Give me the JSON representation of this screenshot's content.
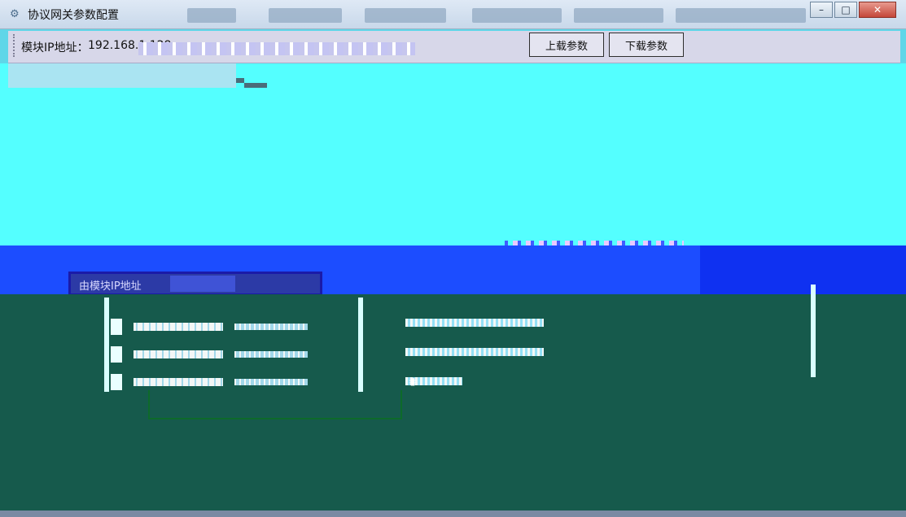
{
  "window": {
    "title": "协议网关参数配置",
    "controls": {
      "minimize": "–",
      "maximize": "□",
      "close": "✕"
    }
  },
  "toolbar": {
    "ip_label": "模块IP地址：",
    "ip_value": "192.168.1.128",
    "upload_button": "上载参数",
    "download_button": "下载参数"
  },
  "panel": {
    "label": "由模块IP地址"
  },
  "colors": {
    "cyan": "#54ffff",
    "blue": "#1c4dff",
    "green": "#165a4c"
  },
  "icons": {
    "app_icon": "gear-icon",
    "grip_icon": "grip-icon",
    "alert_icon": "alert-icon"
  }
}
